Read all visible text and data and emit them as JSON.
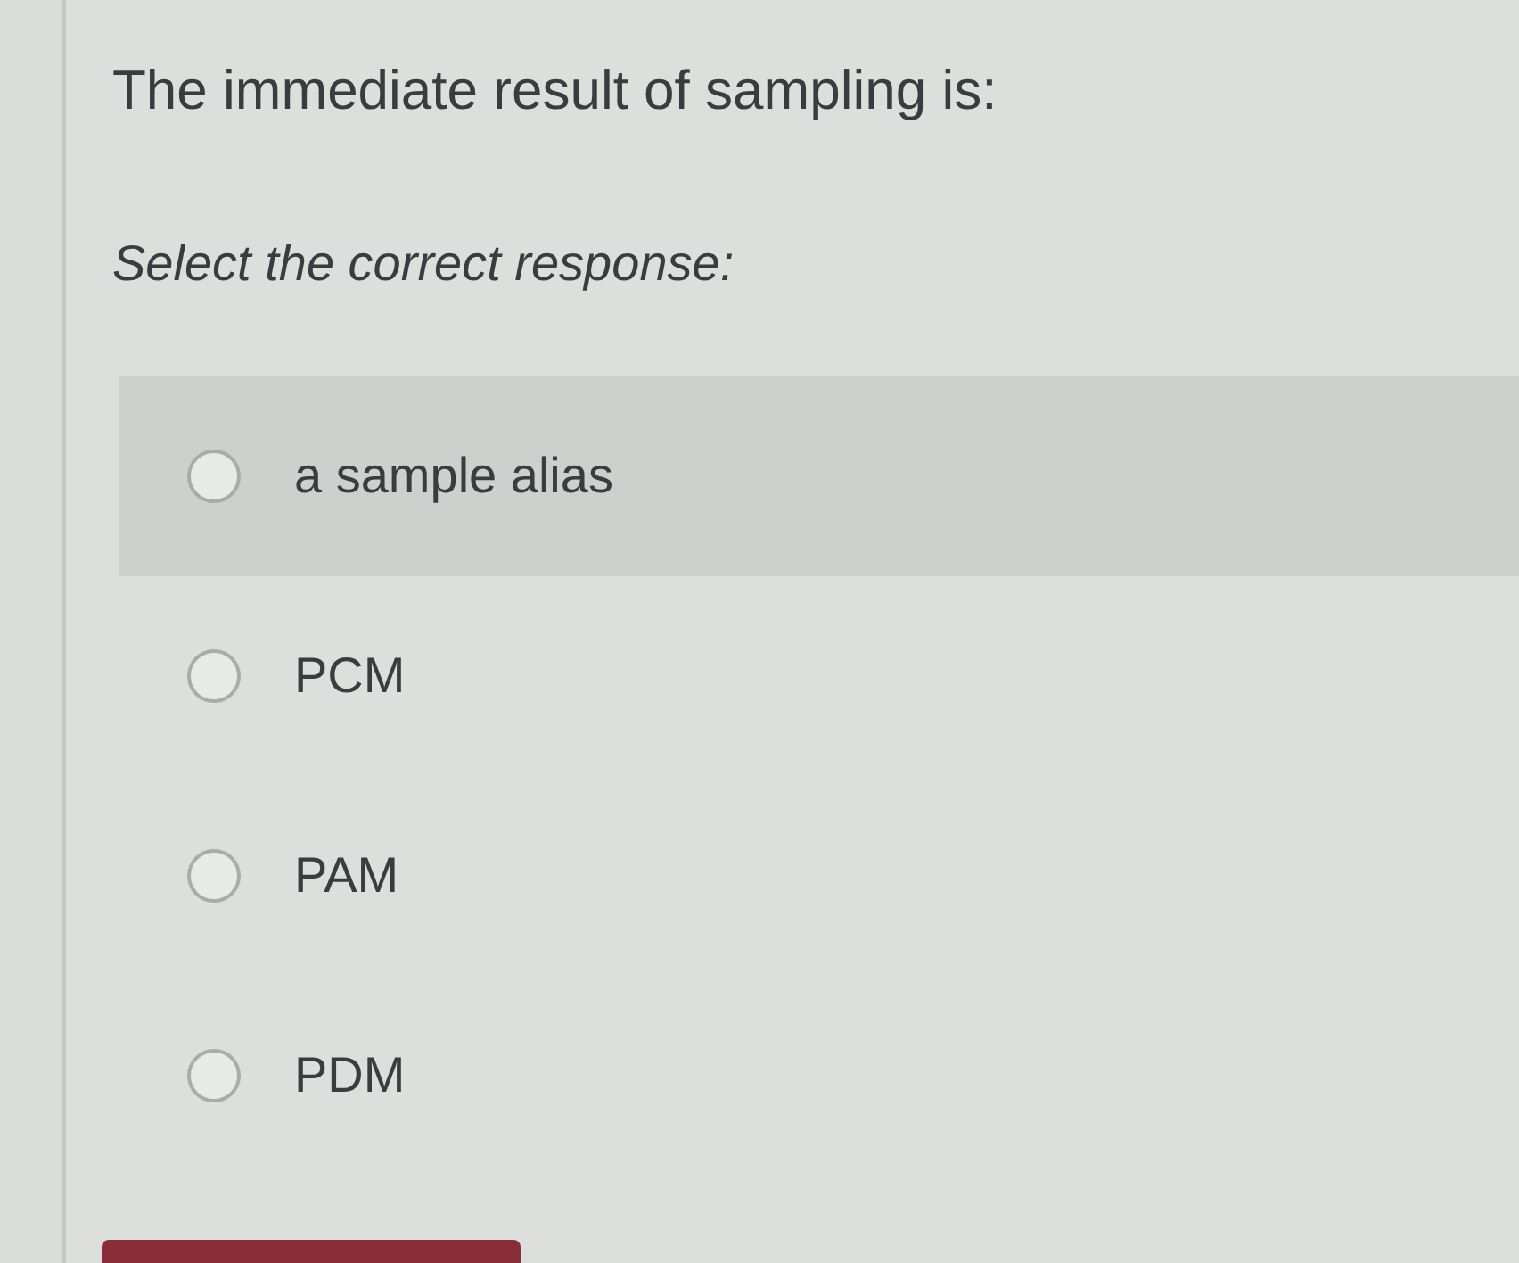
{
  "question": "The immediate result of sampling is:",
  "instruction": "Select the correct response:",
  "options": [
    {
      "label": "a sample alias",
      "selected": false,
      "highlighted": true
    },
    {
      "label": "PCM",
      "selected": false,
      "highlighted": false
    },
    {
      "label": "PAM",
      "selected": false,
      "highlighted": false
    },
    {
      "label": "PDM",
      "selected": false,
      "highlighted": false
    }
  ]
}
